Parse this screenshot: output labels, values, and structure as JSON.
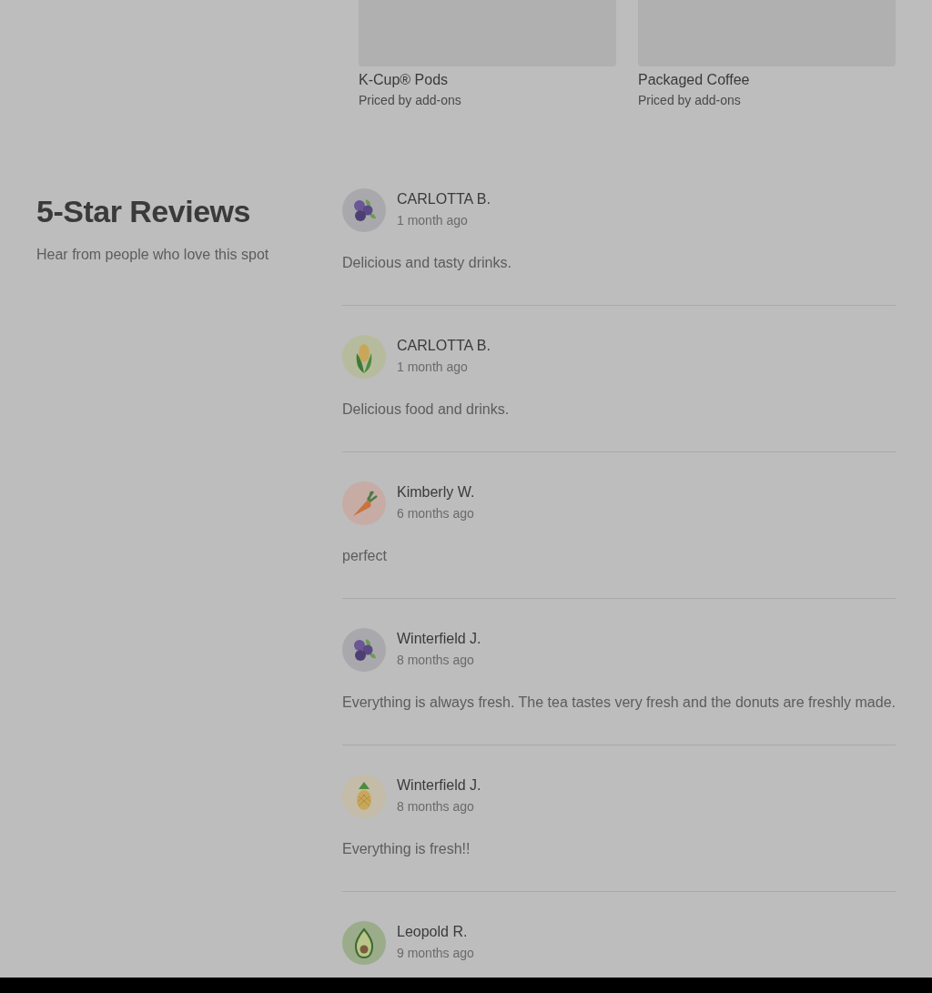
{
  "products": [
    {
      "title": "K-Cup® Pods",
      "price": "Priced by add-ons"
    },
    {
      "title": "Packaged Coffee",
      "price": "Priced by add-ons"
    }
  ],
  "reviews_section": {
    "title": "5-Star Reviews",
    "subtitle": "Hear from people who love this spot"
  },
  "reviews": [
    {
      "name": "CARLOTTA B.",
      "time": "1 month ago",
      "text": "Delicious and tasty drinks.",
      "avatar": {
        "kind": "blueberry"
      }
    },
    {
      "name": "CARLOTTA B.",
      "time": "1 month ago",
      "text": "Delicious food and drinks.",
      "avatar": {
        "kind": "corn"
      }
    },
    {
      "name": "Kimberly W.",
      "time": "6 months ago",
      "text": "perfect",
      "avatar": {
        "kind": "carrot"
      }
    },
    {
      "name": "Winterfield J.",
      "time": "8 months ago",
      "text": "Everything is always fresh. The tea tastes very fresh and the donuts are freshly made.",
      "avatar": {
        "kind": "blueberry"
      }
    },
    {
      "name": "Winterfield J.",
      "time": "8 months ago",
      "text": "Everything is fresh!!",
      "avatar": {
        "kind": "pineapple"
      }
    },
    {
      "name": "Leopold R.",
      "time": "9 months ago",
      "avatar": {
        "kind": "avocado"
      }
    }
  ]
}
